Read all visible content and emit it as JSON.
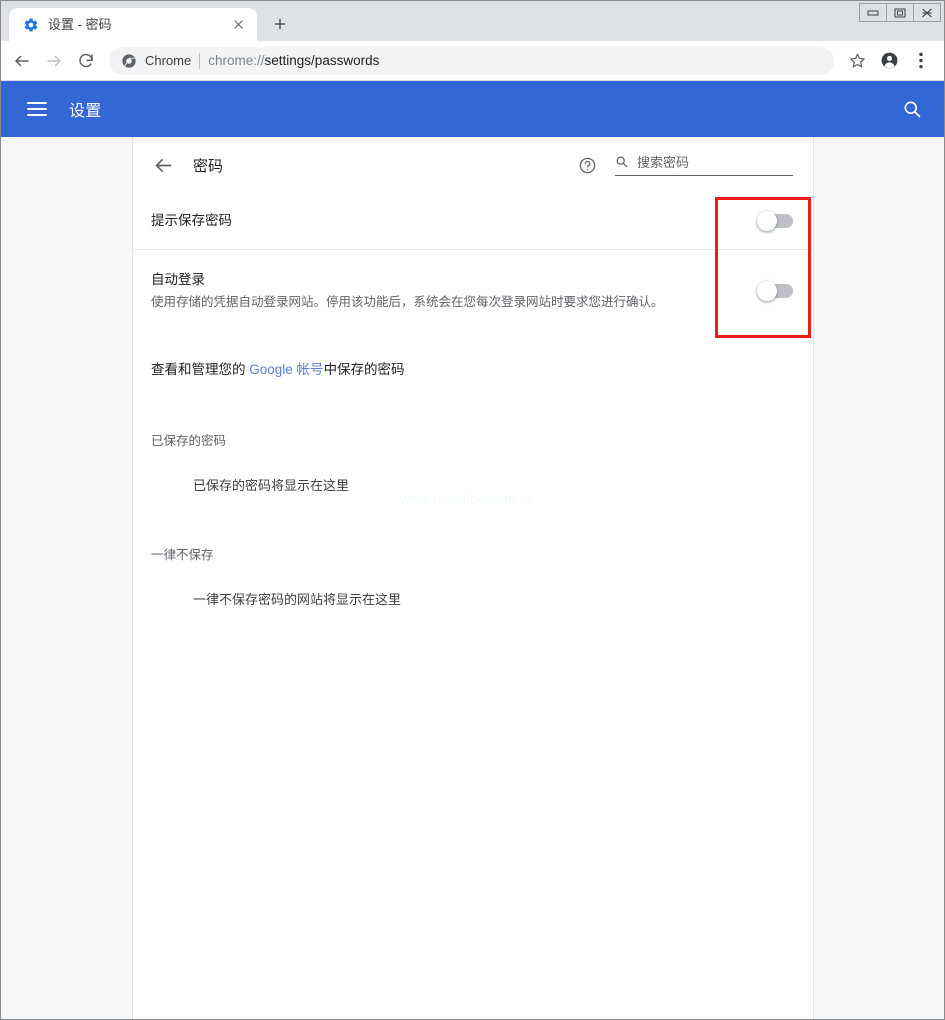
{
  "window": {
    "controls": [
      {
        "name": "minimize",
        "glyph": "minimize-icon"
      },
      {
        "name": "maximize",
        "glyph": "maximize-icon"
      },
      {
        "name": "close",
        "glyph": "close-icon"
      }
    ]
  },
  "tabstrip": {
    "tab_title": "设置 - 密码",
    "favicon": "settings-gear-icon",
    "close_icon": "close-icon",
    "new_tab_icon": "plus-icon"
  },
  "toolbar": {
    "back_icon": "back-arrow-icon",
    "forward_icon": "forward-arrow-icon",
    "reload_icon": "reload-icon",
    "site_icon": "chrome-icon",
    "chip_label": "Chrome",
    "url_scheme": "chrome://",
    "url_path": "settings/passwords",
    "bookmark_icon": "star-icon",
    "profile_icon": "account-avatar-icon",
    "menu_icon": "three-dot-menu-icon"
  },
  "settings_header": {
    "menu_icon": "hamburger-menu-icon",
    "title": "设置",
    "search_icon": "search-icon"
  },
  "passwords_page": {
    "back_icon": "back-arrow-icon",
    "title": "密码",
    "help_icon": "help-circle-icon",
    "search": {
      "icon": "search-icon",
      "placeholder": "搜索密码",
      "value": ""
    },
    "settings": [
      {
        "label": "提示保存密码",
        "sublabel": "",
        "toggle_state": "off"
      },
      {
        "label": "自动登录",
        "sublabel": "使用存储的凭据自动登录网站。停用该功能后，系统会在您每次登录网站时要求您进行确认。",
        "toggle_state": "off"
      }
    ],
    "account_row": {
      "prefix": "查看和管理您的 ",
      "link": "Google 帐号",
      "suffix": "中保存的密码"
    },
    "sections": [
      {
        "title": "已保存的密码",
        "empty_text": "已保存的密码将显示在这里"
      },
      {
        "title": "一律不保存",
        "empty_text": "一律不保存密码的网站将显示在这里"
      }
    ]
  },
  "annotation": {
    "color": "#ee1b1b"
  },
  "watermark": {
    "text": "www.pconline.com.cn"
  }
}
